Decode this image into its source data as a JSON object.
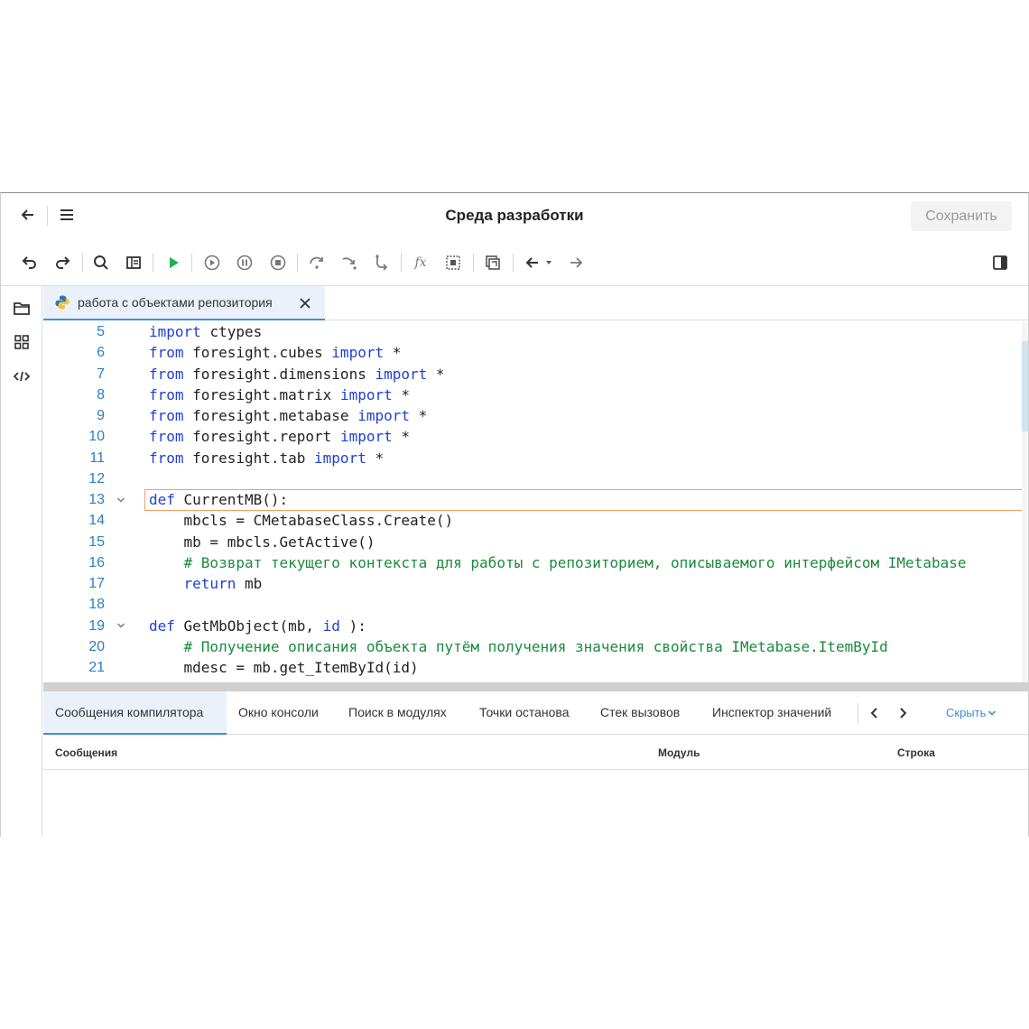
{
  "header": {
    "title": "Среда разработки",
    "save_label": "Сохранить"
  },
  "icons": {
    "back": "arrow-left-icon",
    "menu": "hamburger-menu-icon",
    "undo": "undo-icon",
    "redo": "redo-icon",
    "search": "search-icon",
    "module": "module-view-icon",
    "run": "play-icon",
    "run_debug": "run-circle-icon",
    "pause": "pause-icon",
    "stop": "stop-icon",
    "step_over": "step-over-icon",
    "step_into": "step-into-icon",
    "step_out": "step-out-icon",
    "fx": "function-icon",
    "breakpoint": "breakpoint-icon",
    "copy": "copy-icon",
    "nav_back": "navigate-back-icon",
    "nav_forward": "navigate-forward-icon",
    "panel": "side-panel-icon",
    "folder": "folder-icon",
    "grid": "grid-icon",
    "code": "code-icon",
    "python": "python-icon",
    "close": "close-icon"
  },
  "colors": {
    "accent": "#3d8fd6",
    "keyword": "#1f3fd6",
    "comment": "#1b8a3c",
    "line_number": "#2c7fc2",
    "run": "#22b14c"
  },
  "toolbar": {
    "fx_label": "fx"
  },
  "tab": {
    "label": "работа с объектами репозитория"
  },
  "editor": {
    "lines": [
      {
        "n": "5",
        "segs": [
          [
            "kw",
            "import"
          ],
          [
            "",
            "ctypes"
          ]
        ]
      },
      {
        "n": "6",
        "segs": [
          [
            "kw",
            "from"
          ],
          [
            "",
            "foresight.cubes "
          ],
          [
            "kw",
            "import"
          ],
          [
            "",
            " *"
          ]
        ]
      },
      {
        "n": "7",
        "segs": [
          [
            "kw",
            "from"
          ],
          [
            "",
            "foresight.dimensions "
          ],
          [
            "kw",
            "import"
          ],
          [
            "",
            " *"
          ]
        ]
      },
      {
        "n": "8",
        "segs": [
          [
            "kw",
            "from"
          ],
          [
            "",
            "foresight.matrix "
          ],
          [
            "kw",
            "import"
          ],
          [
            "",
            " *"
          ]
        ]
      },
      {
        "n": "9",
        "segs": [
          [
            "kw",
            "from"
          ],
          [
            "",
            "foresight.metabase "
          ],
          [
            "kw",
            "import"
          ],
          [
            "",
            " *"
          ]
        ]
      },
      {
        "n": "10",
        "segs": [
          [
            "kw",
            "from"
          ],
          [
            "",
            "foresight.report "
          ],
          [
            "kw",
            "import"
          ],
          [
            "",
            " *"
          ]
        ]
      },
      {
        "n": "11",
        "segs": [
          [
            "kw",
            "from"
          ],
          [
            "",
            "foresight.tab "
          ],
          [
            "kw",
            "import"
          ],
          [
            "",
            " *"
          ]
        ]
      },
      {
        "n": "12",
        "segs": []
      },
      {
        "n": "13",
        "fold": true,
        "segs": [
          [
            "kw",
            "def"
          ],
          [
            "",
            "CurrentMB():"
          ]
        ]
      },
      {
        "n": "14",
        "segs": [
          [
            "",
            "    mbcls = CMetabaseClass.Create()"
          ]
        ]
      },
      {
        "n": "15",
        "segs": [
          [
            "",
            "    mb = mbcls.GetActive()"
          ]
        ]
      },
      {
        "n": "16",
        "segs": [
          [
            "cm",
            "    # Возврат текущего контекста для работы с репозиторием, описываемого интерфейсом IMetabase"
          ]
        ]
      },
      {
        "n": "17",
        "segs": [
          [
            "kw",
            "    return"
          ],
          [
            "",
            " mb"
          ]
        ]
      },
      {
        "n": "18",
        "segs": []
      },
      {
        "n": "19",
        "fold": true,
        "segs": [
          [
            "kw",
            "def"
          ],
          [
            "",
            "GetMbObject(mb, "
          ],
          [
            "kw",
            "id"
          ],
          [
            "",
            "):"
          ]
        ]
      },
      {
        "n": "20",
        "segs": [
          [
            "cm",
            "    # Получение описания объекта путём получения значения свойства IMetabase.ItemById"
          ]
        ]
      },
      {
        "n": "21",
        "segs": [
          [
            "",
            "    mdesc = mb.get_ItemById(id)"
          ]
        ]
      }
    ]
  },
  "bottom": {
    "tabs": [
      "Сообщения компилятора",
      "Окно консоли",
      "Поиск в модулях",
      "Точки останова",
      "Стек вызовов",
      "Инспектор значений"
    ],
    "hide_label": "Скрыть",
    "columns": [
      "Сообщения",
      "Модуль",
      "Строка"
    ]
  }
}
